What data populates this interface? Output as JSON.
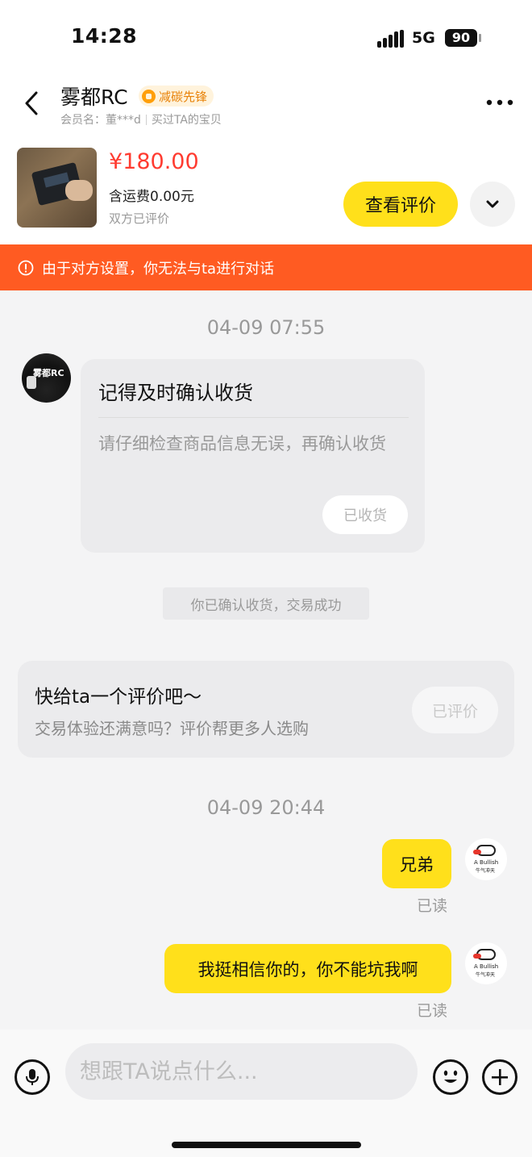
{
  "status_bar": {
    "time": "14:28",
    "network": "5G",
    "battery": "90"
  },
  "header": {
    "shop_name": "雾都RC",
    "badge": "减碳先锋",
    "member_label": "会员名：董***d",
    "purchase_note": "买过TA的宝贝"
  },
  "product": {
    "price": "¥180.00",
    "shipping": "含运费0.00元",
    "review_status": "双方已评价",
    "review_button": "查看评价"
  },
  "warning": {
    "text": "由于对方设置，你无法与ta进行对话",
    "color": "#ff5b22"
  },
  "chat": {
    "timestamp1": "04-09 07:55",
    "shop_avatar_text": "雾都RC",
    "card": {
      "title": "记得及时确认收货",
      "body": "请仔细检查商品信息无误，再确认收货",
      "button": "已收货"
    },
    "system_note": "你已确认收货，交易成功",
    "rate_card": {
      "title": "快给ta一个评价吧～",
      "subtitle": "交易体验还满意吗？评价帮更多人选购",
      "button": "已评价"
    },
    "timestamp2": "04-09 20:44",
    "my_avatar_text": "A Bullish",
    "my_avatar_subtext": "牛气冲天",
    "messages": [
      {
        "text": "兄弟",
        "status": "已读"
      },
      {
        "text": "我挺相信你的，你不能坑我啊",
        "status": "已读"
      }
    ]
  },
  "input": {
    "placeholder": "想跟TA说点什么..."
  },
  "colors": {
    "accent_yellow": "#ffe01b",
    "price_red": "#ff3b30"
  }
}
